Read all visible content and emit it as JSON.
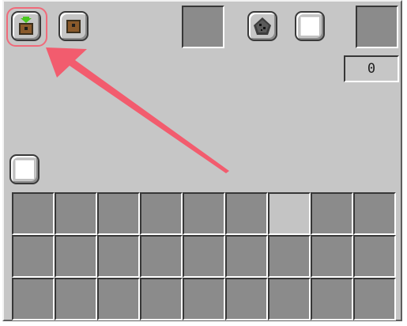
{
  "icons": {
    "device_active": "chest-with-green-arrow-icon",
    "device": "chest-icon",
    "ore": "coal-ore-icon",
    "toggle_top": "white-square-icon",
    "toggle_left": "white-square-icon"
  },
  "counter": {
    "value": "0"
  },
  "grid": {
    "rows": 3,
    "cols": 9,
    "highlighted": [
      [
        0,
        6
      ]
    ]
  },
  "colors": {
    "panel": "#c6c6c6",
    "slot": "#8b8b8b",
    "annotation": "#f25c6e",
    "accent_green": "#49c81e"
  }
}
